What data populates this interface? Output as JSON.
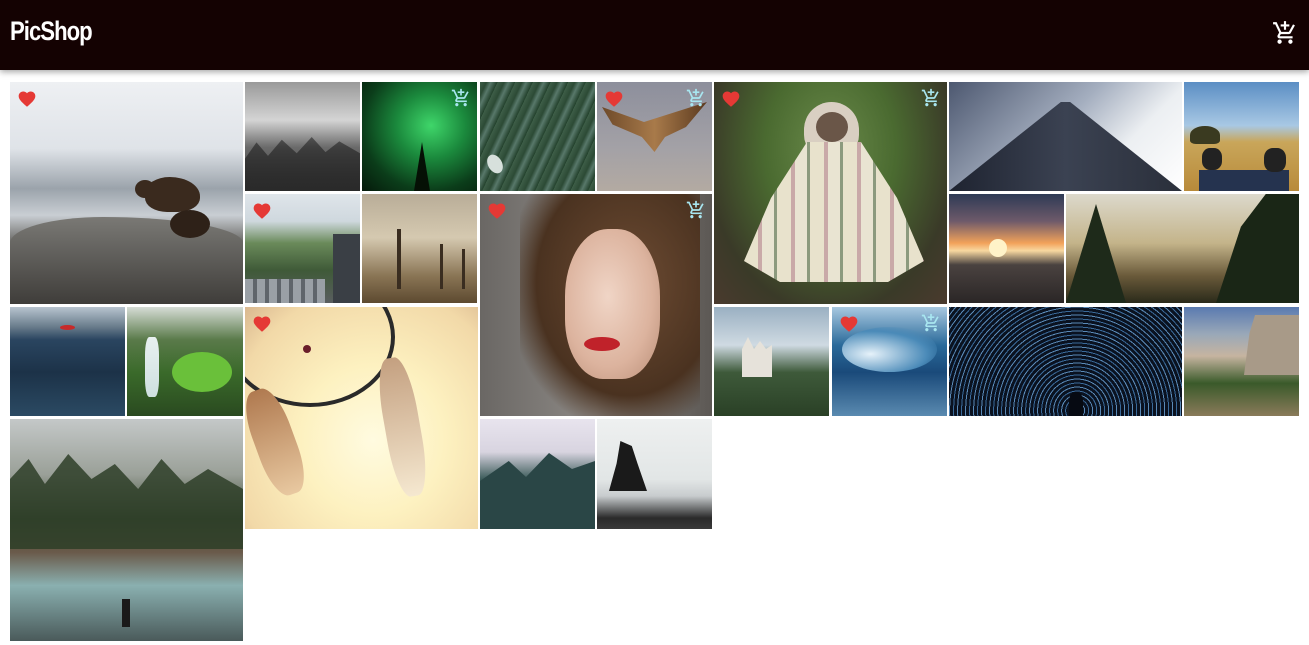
{
  "app": {
    "title": "PicShop",
    "cart_icon": "cart-plus-icon"
  },
  "colors": {
    "header_bg": "#140202",
    "favorite": "#e53935",
    "cart_overlay": "#a8e6f0"
  },
  "icons": {
    "favorite": "heart-icon",
    "cart": "add-to-cart-icon"
  },
  "photos": [
    {
      "id": "bear",
      "favorited": true,
      "cart_icon": false
    },
    {
      "id": "misty-forest-bw",
      "favorited": false,
      "cart_icon": false
    },
    {
      "id": "aurora",
      "favorited": false,
      "cart_icon": true
    },
    {
      "id": "pine-forest",
      "favorited": false,
      "cart_icon": false
    },
    {
      "id": "eagle",
      "favorited": true,
      "cart_icon": true
    },
    {
      "id": "pug-blanket",
      "favorited": true,
      "cart_icon": true
    },
    {
      "id": "skyscraper",
      "favorited": false,
      "cart_icon": false
    },
    {
      "id": "sneakers-field",
      "favorited": false,
      "cart_icon": false
    },
    {
      "id": "city-park",
      "favorited": true,
      "cart_icon": false
    },
    {
      "id": "foggy-dead-trees",
      "favorited": false,
      "cart_icon": false
    },
    {
      "id": "woman-portrait",
      "favorited": true,
      "cart_icon": true
    },
    {
      "id": "train-sunset",
      "favorited": false,
      "cart_icon": false
    },
    {
      "id": "valley-sunrise",
      "favorited": false,
      "cart_icon": false
    },
    {
      "id": "ocean-kayak",
      "favorited": false,
      "cart_icon": false
    },
    {
      "id": "waterfall",
      "favorited": false,
      "cart_icon": false
    },
    {
      "id": "dreamcatcher",
      "favorited": true,
      "cart_icon": false
    },
    {
      "id": "castle",
      "favorited": false,
      "cart_icon": false
    },
    {
      "id": "wave",
      "favorited": true,
      "cart_icon": true
    },
    {
      "id": "star-trails",
      "favorited": false,
      "cart_icon": false
    },
    {
      "id": "yosemite",
      "favorited": false,
      "cart_icon": false
    },
    {
      "id": "river-hiker",
      "favorited": false,
      "cart_icon": false
    },
    {
      "id": "misty-mountain",
      "favorited": false,
      "cart_icon": false
    },
    {
      "id": "sea-stack",
      "favorited": false,
      "cart_icon": false
    }
  ]
}
